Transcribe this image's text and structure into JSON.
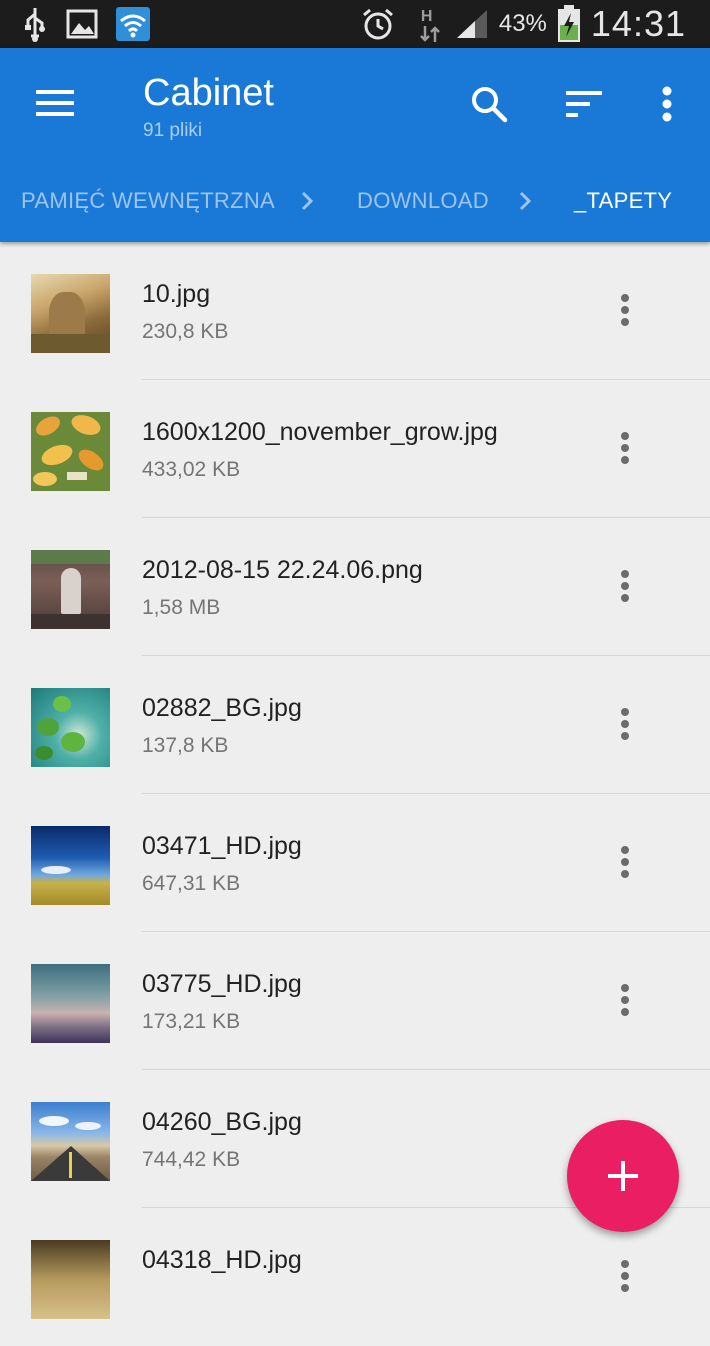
{
  "status_bar": {
    "time": "14:31",
    "battery_percent": "43%",
    "network_type": "H",
    "icons": [
      "usb-icon",
      "image-icon",
      "wifi-icon",
      "alarm-icon",
      "data-arrows-icon",
      "signal-icon",
      "battery-charging-icon"
    ]
  },
  "app_bar": {
    "title": "Cabinet",
    "subtitle": "91 pliki",
    "actions": [
      "menu-icon",
      "search-icon",
      "sort-icon",
      "overflow-menu-icon"
    ],
    "color": "#1a79d7"
  },
  "breadcrumb": [
    {
      "label": "PAMIĘĆ WEWNĘTRZNA"
    },
    {
      "label": "DOWNLOAD"
    },
    {
      "label": "_TAPETY"
    }
  ],
  "files": [
    {
      "name": "10.jpg",
      "size": "230,8 KB"
    },
    {
      "name": "1600x1200_november_grow.jpg",
      "size": "433,02 KB"
    },
    {
      "name": "2012-08-15 22.24.06.png",
      "size": "1,58 MB"
    },
    {
      "name": "02882_BG.jpg",
      "size": "137,8 KB"
    },
    {
      "name": "03471_HD.jpg",
      "size": "647,31 KB"
    },
    {
      "name": "03775_HD.jpg",
      "size": "173,21 KB"
    },
    {
      "name": "04260_BG.jpg",
      "size": "744,42 KB"
    },
    {
      "name": "04318_HD.jpg",
      "size": ""
    }
  ],
  "fab": {
    "icon": "add-icon",
    "color": "#e91e63"
  }
}
